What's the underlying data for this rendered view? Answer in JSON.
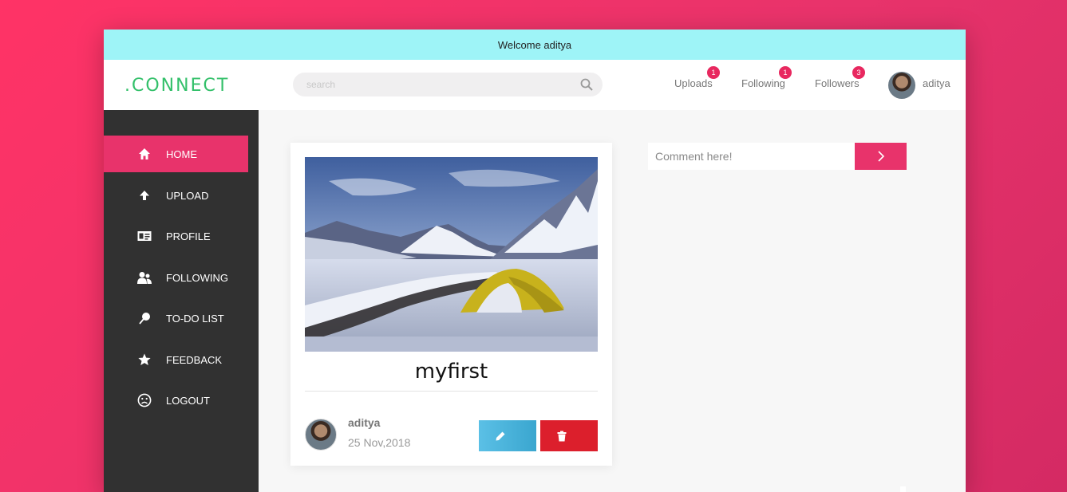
{
  "welcome": "Welcome aditya",
  "brand": ".CONNECT",
  "search": {
    "placeholder": "search"
  },
  "nav": {
    "links": [
      {
        "label": "Uploads",
        "count": "1"
      },
      {
        "label": "Following",
        "count": "1"
      },
      {
        "label": "Followers",
        "count": "3"
      }
    ],
    "username": "aditya"
  },
  "sidebar": {
    "items": [
      {
        "label": "HOME",
        "icon": "home-icon",
        "active": true
      },
      {
        "label": "UPLOAD",
        "icon": "arrow-up-icon"
      },
      {
        "label": "PROFILE",
        "icon": "id-card-icon"
      },
      {
        "label": "FOLLOWING",
        "icon": "users-icon"
      },
      {
        "label": "TO-DO LIST",
        "icon": "pushpin-icon"
      },
      {
        "label": "FEEDBACK",
        "icon": "star-icon"
      },
      {
        "label": "LOGOUT",
        "icon": "sad-face-icon"
      }
    ]
  },
  "post": {
    "title": "myfirst",
    "author": "aditya",
    "date": "25 Nov,2018",
    "edit_icon": "pencil-icon",
    "delete_icon": "trash-icon"
  },
  "comment": {
    "placeholder": "Comment here!",
    "send_icon": "chevron-right-icon"
  },
  "colors": {
    "accent": "#e8336b",
    "welcome_bar": "#9ef4f7",
    "brand": "#33c06a",
    "sidebar": "#313131",
    "edit": "#4bb5de",
    "delete": "#dc1f2c"
  }
}
